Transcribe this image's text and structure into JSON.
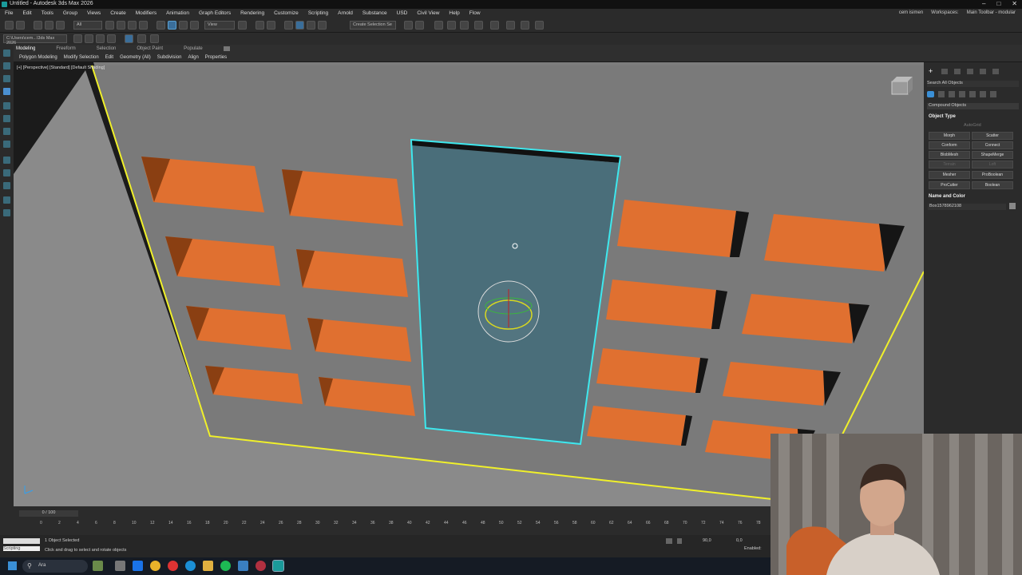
{
  "app": {
    "window_title": "Untitled - Autodesk 3ds Max 2026"
  },
  "menu": {
    "items": [
      "File",
      "Edit",
      "Tools",
      "Group",
      "Views",
      "Create",
      "Modifiers",
      "Animation",
      "Graph Editors",
      "Rendering",
      "Customize",
      "Scripting",
      "Arnold",
      "Substance",
      "USD",
      "Civil View",
      "Help",
      "Flow"
    ],
    "user": "cem isimen",
    "workspaces_label": "Workspaces:",
    "workspace_value": "Main Toolbar - modular"
  },
  "toolbar": {
    "selection_filter": "All",
    "coord_system": "View",
    "selection_set_placeholder": "Create Selection Se",
    "path": "C:\\Users\\cem...\\3ds Max 2026"
  },
  "ribbon": {
    "tabs": [
      "Modeling",
      "Freeform",
      "Selection",
      "Object Paint",
      "Populate"
    ],
    "active_tab": "Modeling",
    "sub": [
      "Polygon Modeling",
      "Modify Selection",
      "Edit",
      "Geometry (All)",
      "Subdivision",
      "Align",
      "Properties"
    ]
  },
  "viewport": {
    "label": "[+] [Perspective] [Standard] [Default Shading]"
  },
  "command_panel": {
    "search_placeholder": "Search All Objects",
    "category": "Compound Objects",
    "object_type_header": "Object Type",
    "autogrid": "AutoGrid",
    "buttons": [
      {
        "label": "Morph",
        "enabled": true
      },
      {
        "label": "Scatter",
        "enabled": true
      },
      {
        "label": "Conform",
        "enabled": true
      },
      {
        "label": "Connect",
        "enabled": true
      },
      {
        "label": "BlobMesh",
        "enabled": true
      },
      {
        "label": "ShapeMerge",
        "enabled": true
      },
      {
        "label": "Terrain",
        "enabled": false
      },
      {
        "label": "Loft",
        "enabled": false
      },
      {
        "label": "Mesher",
        "enabled": true
      },
      {
        "label": "ProBoolean",
        "enabled": true
      },
      {
        "label": "ProCutter",
        "enabled": true
      },
      {
        "label": "Boolean",
        "enabled": true
      }
    ],
    "name_color_header": "Name and Color",
    "object_name": "Box1578962108"
  },
  "timeline": {
    "frame_display": "0 / 100",
    "ticks": [
      "0",
      "2",
      "4",
      "6",
      "8",
      "10",
      "12",
      "14",
      "16",
      "18",
      "20",
      "22",
      "24",
      "26",
      "28",
      "30",
      "32",
      "34",
      "36",
      "38",
      "40",
      "42",
      "44",
      "46",
      "48",
      "50",
      "52",
      "54",
      "56",
      "58",
      "60",
      "62",
      "64",
      "66",
      "68",
      "70",
      "72",
      "74",
      "76",
      "78"
    ]
  },
  "status": {
    "selection": "1 Object Selected",
    "prompt": "Click and drag to select and rotate objects",
    "listener": "Scripting",
    "x_value": "90,0",
    "z_value": "0,0",
    "enabled_label": "Enabled:"
  },
  "taskbar": {
    "search": "Ara"
  },
  "colors": {
    "viewport_bg": "#7d7d7d",
    "ceiling": "#7a7a7a",
    "panel_orange": "#e07030",
    "selected_box": "#4a6e7a",
    "selection_outline": "#3ee8ee",
    "room_edge": "#f0f02a",
    "accent_blue": "#3a8fd6"
  }
}
